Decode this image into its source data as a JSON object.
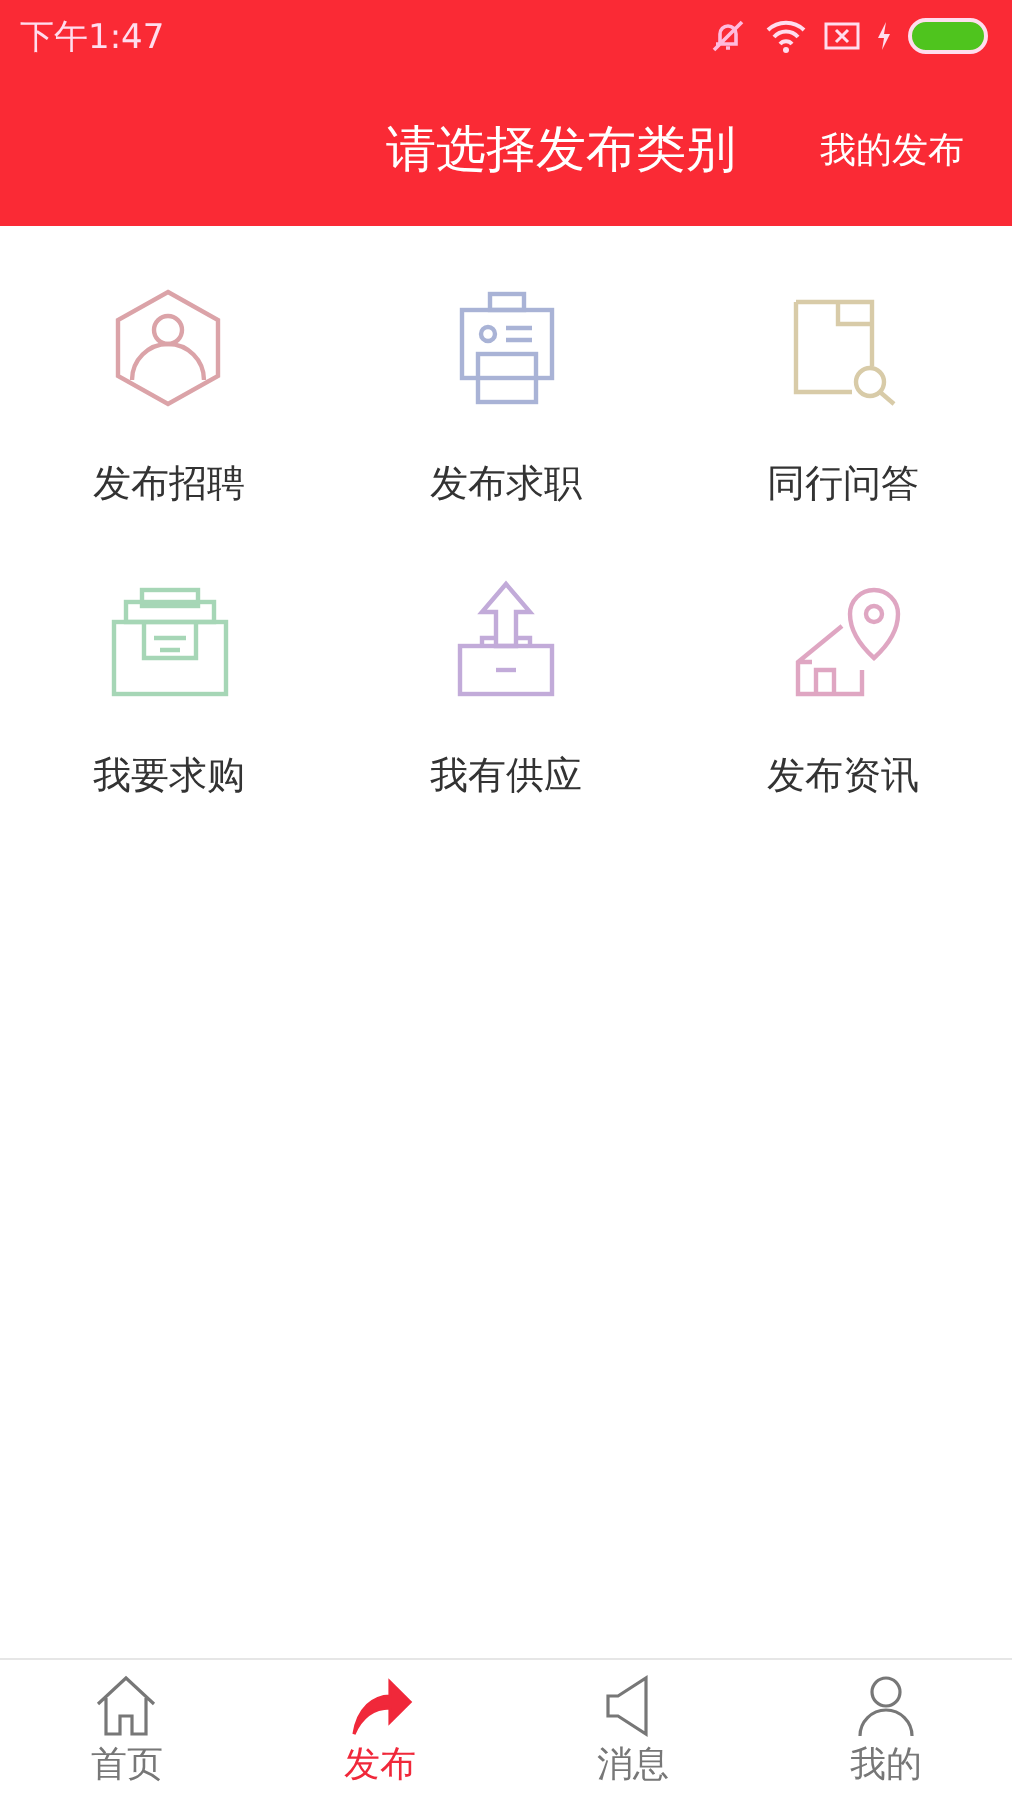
{
  "status_bar": {
    "time": "下午1:47"
  },
  "header": {
    "title": "请选择发布类别",
    "action": "我的发布"
  },
  "categories": [
    {
      "label": "发布招聘",
      "color": "#dba3a8"
    },
    {
      "label": "发布求职",
      "color": "#a9b3d6"
    },
    {
      "label": "同行问答",
      "color": "#d8cba8"
    },
    {
      "label": "我要求购",
      "color": "#a6d6b6"
    },
    {
      "label": "我有供应",
      "color": "#c2abd9"
    },
    {
      "label": "发布资讯",
      "color": "#dfa6c2"
    }
  ],
  "tabs": [
    {
      "label": "首页",
      "selected": false
    },
    {
      "label": "发布",
      "selected": true
    },
    {
      "label": "消息",
      "selected": false
    },
    {
      "label": "我的",
      "selected": false
    }
  ]
}
